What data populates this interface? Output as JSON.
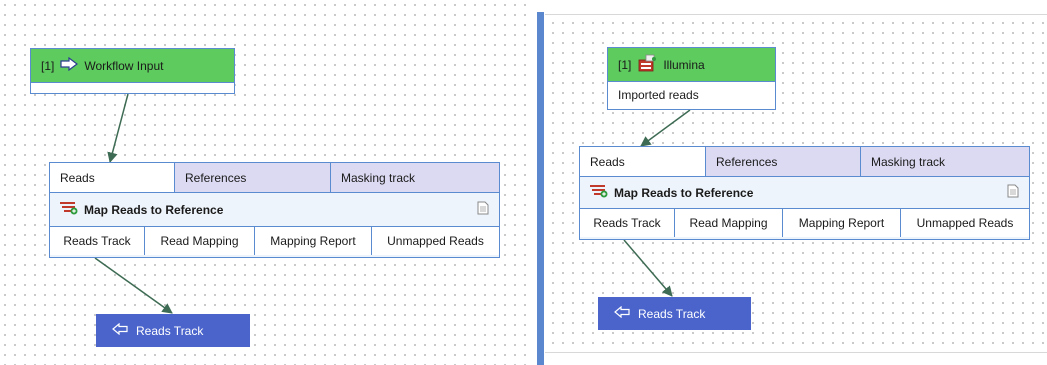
{
  "left": {
    "input": {
      "index": "[1]",
      "label": "Workflow Input",
      "icon": "arrow-right-outline-icon"
    },
    "tool": {
      "ports": [
        "Reads",
        "References",
        "Masking track"
      ],
      "title": "Map Reads to Reference",
      "outputs": [
        "Reads Track",
        "Read Mapping",
        "Mapping Report",
        "Unmapped Reads"
      ]
    },
    "output": {
      "label": "Reads Track",
      "icon": "arrow-left-outline-icon"
    }
  },
  "right": {
    "input": {
      "index": "[1]",
      "label": "Illumina",
      "sublabel": "Imported reads",
      "icon": "illumina-sequencer-icon"
    },
    "tool": {
      "ports": [
        "Reads",
        "References",
        "Masking track"
      ],
      "title": "Map Reads to Reference",
      "outputs": [
        "Reads Track",
        "Read Mapping",
        "Mapping Report",
        "Unmapped Reads"
      ]
    },
    "output": {
      "label": "Reads Track",
      "icon": "arrow-left-outline-icon"
    }
  },
  "colors": {
    "input_header": "#5ecb5e",
    "node_border": "#5a8ad0",
    "output_node": "#4a64cc",
    "port_active": "#ffffff",
    "port_inactive": "#dcdaf2",
    "divider": "#5b87cf"
  }
}
